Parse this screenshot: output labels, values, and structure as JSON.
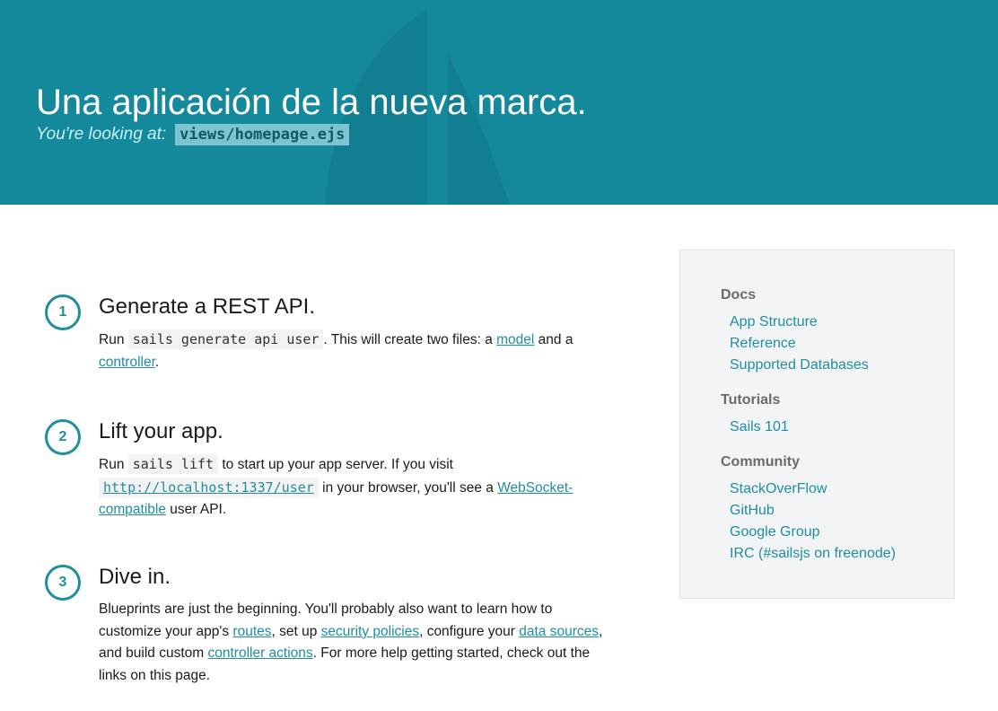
{
  "header": {
    "title": "Una aplicación de la nueva marca.",
    "subtitle_label": "You're looking at:",
    "subtitle_file": "views/homepage.ejs"
  },
  "steps": [
    {
      "number": "1",
      "title": "Generate a REST API.",
      "parts": {
        "t1": "Run ",
        "code1": "sails generate api user",
        "t2": ". This will create two files: a ",
        "link_model": "model",
        "t3": " and a ",
        "link_controller": "controller",
        "t4": "."
      }
    },
    {
      "number": "2",
      "title": "Lift your app.",
      "parts": {
        "t1": "Run ",
        "code1": "sails lift",
        "t2": " to start up your app server. If you visit ",
        "link_url": "http://localhost:1337/user",
        "t3": " in your browser, you'll see a ",
        "link_websocket": "WebSocket-compatible",
        "t4": " user API."
      }
    },
    {
      "number": "3",
      "title": "Dive in.",
      "parts": {
        "t1": "Blueprints are just the beginning. You'll probably also want to learn how to customize your app's ",
        "link_routes": "routes",
        "t2": ", set up ",
        "link_security": "security policies",
        "t3": ", configure your ",
        "link_datasources": "data sources",
        "t4": ", and build custom ",
        "link_actions": "controller actions",
        "t5": ". For more help getting started, check out the links on this page."
      }
    }
  ],
  "sidebar": {
    "sections": [
      {
        "heading": "Docs",
        "links": [
          "App Structure",
          "Reference",
          "Supported Databases"
        ]
      },
      {
        "heading": "Tutorials",
        "links": [
          "Sails 101"
        ]
      },
      {
        "heading": "Community",
        "links": [
          "StackOverFlow",
          "GitHub",
          "Google Group",
          "IRC (#sailsjs on freenode)"
        ]
      }
    ]
  },
  "colors": {
    "header_bg": "#13899b",
    "accent": "#1f8ea0",
    "sidebar_bg": "#f3f4f6"
  }
}
